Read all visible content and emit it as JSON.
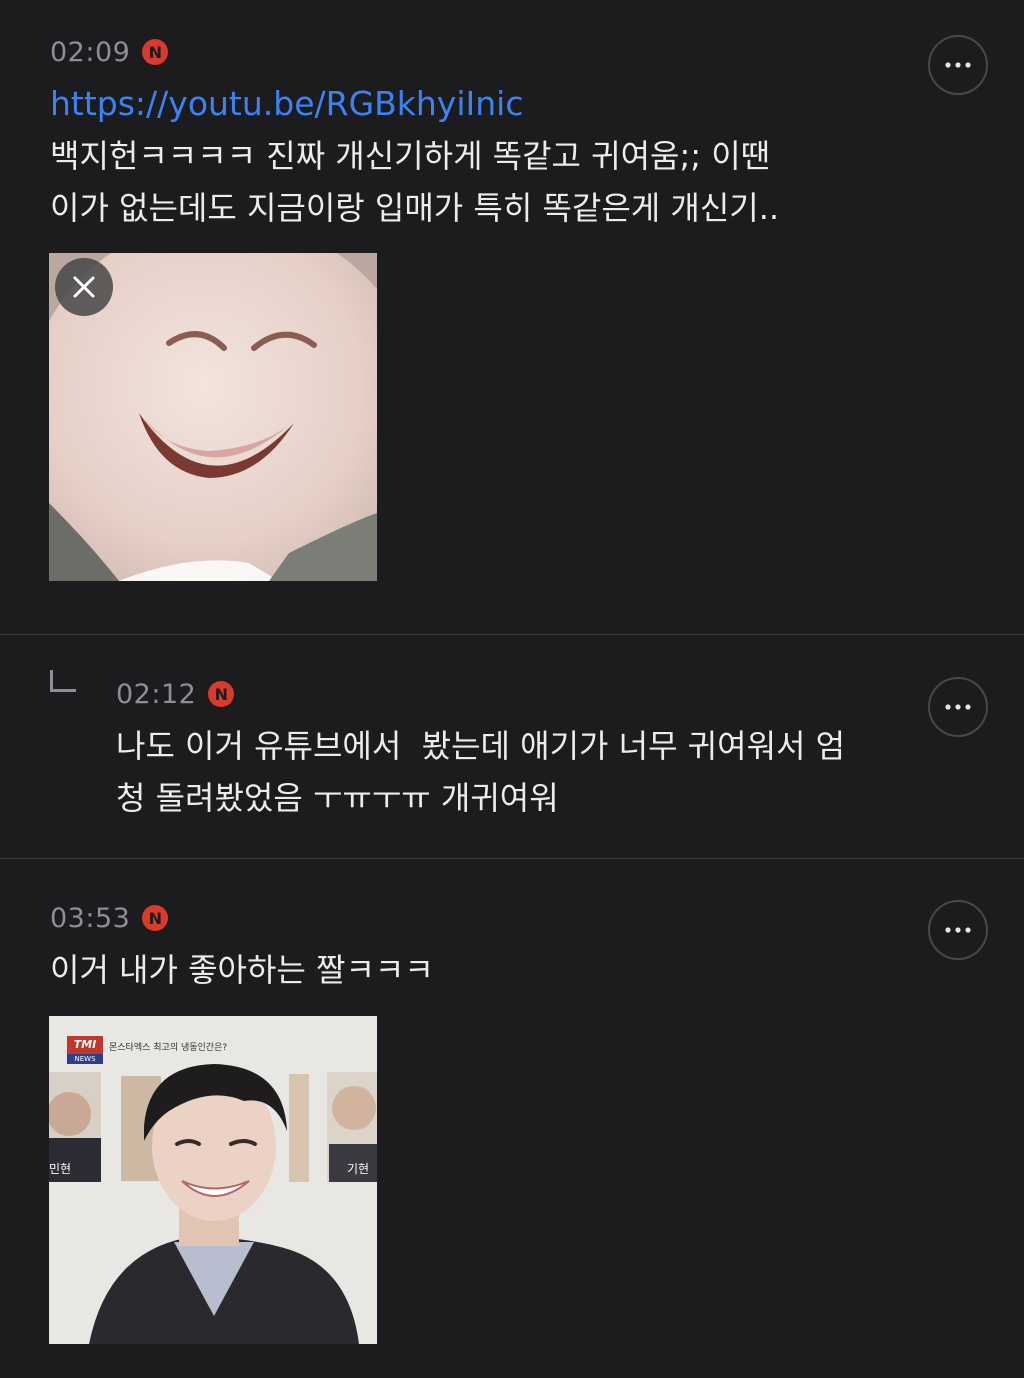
{
  "comments": [
    {
      "time": "02:09",
      "badge": "N",
      "link": "https://youtu.be/RGBkhyiInic",
      "text_lines": [
        "백지헌ㅋㅋㅋㅋ 진짜 개신기하게 똑같고 귀여움;; 이땐",
        "이가 없는데도 지금이랑 입매가 특히 똑같은게 개신기.."
      ],
      "image_icon": "close-icon"
    },
    {
      "time": "02:12",
      "badge": "N",
      "reply_icon": "reply-arrow-icon",
      "text_lines": [
        "나도 이거 유튜브에서  봤는데 애기가 너무 귀여워서 엄",
        "청 돌려봤었음 ㅜㅠㅜㅠ 개귀여워"
      ]
    },
    {
      "time": "03:53",
      "badge": "N",
      "text_lines": [
        "이거 내가 좋아하는 짤ㅋㅋㅋ"
      ],
      "image_caption": {
        "tmi_logo": "TMI",
        "tmi_sub": "NEWS",
        "banner": "몬스타엑스 최고의 냉동인간은?",
        "name_left": "민현",
        "name_right": "기현"
      }
    }
  ],
  "colors": {
    "background": "#1c1c1e",
    "link": "#3b82f6",
    "badge": "#d93a2b",
    "meta": "#8e8e93",
    "divider": "#3a3a3c"
  },
  "icons": [
    "more-options-icon",
    "new-badge-icon",
    "close-icon",
    "reply-arrow-icon"
  ]
}
